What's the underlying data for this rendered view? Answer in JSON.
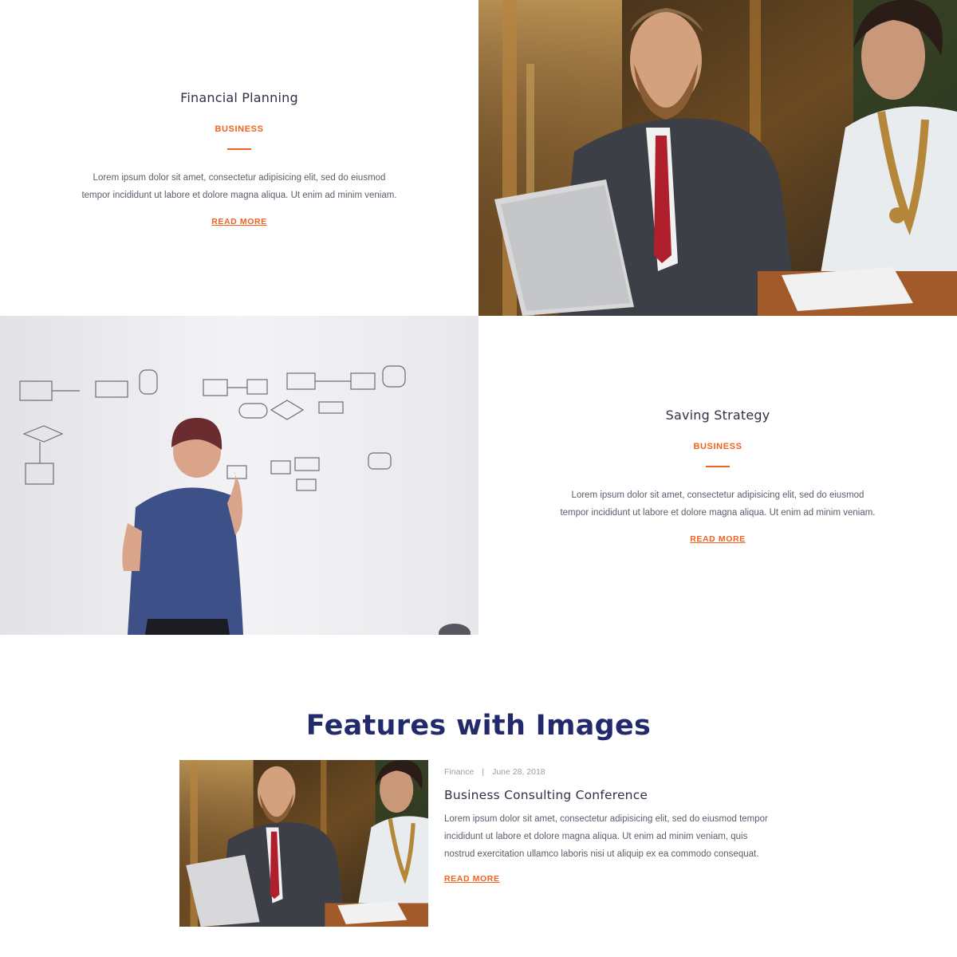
{
  "cards": [
    {
      "title": "Financial Planning",
      "category": "BUSINESS",
      "body_line1": "Lorem ipsum dolor sit amet, consectetur adipisicing elit, sed do eiusmod",
      "body_line2": "tempor incididunt ut labore et dolore magna aliqua. Ut enim ad minim veniam.",
      "read_more": "READ MORE"
    },
    {
      "title": "Saving Strategy",
      "category": "BUSINESS",
      "body_line1": "Lorem ipsum dolor sit amet, consectetur adipisicing elit, sed do eiusmod",
      "body_line2": "tempor incididunt ut labore et dolore magna aliqua. Ut enim ad minim veniam.",
      "read_more": "READ MORE"
    }
  ],
  "features": {
    "title": "Features with Images",
    "item": {
      "category": "Finance",
      "separator": "|",
      "date": "June 28, 2018",
      "heading": "Business Consulting Conference",
      "body": "Lorem ipsum dolor sit amet, consectetur adipisicing elit, sed do eiusmod tempor incididunt ut labore et dolore magna aliqua. Ut enim ad minim veniam, quis nostrud exercitation ullamco laboris nisi ut aliquip ex ea commodo consequat.",
      "read_more": "READ MORE"
    }
  },
  "colors": {
    "accent": "#f0621d",
    "heading": "#2f3147",
    "features_title": "#232a6b",
    "body_text": "#5b5d6b"
  },
  "images": [
    {
      "semantic": "business-meeting-photo"
    },
    {
      "semantic": "whiteboard-flowchart-photo"
    },
    {
      "semantic": "business-meeting-thumbnail"
    }
  ]
}
